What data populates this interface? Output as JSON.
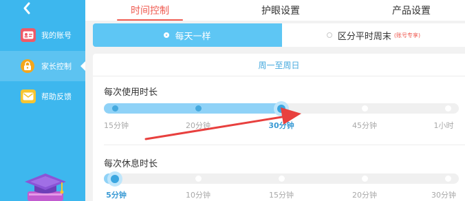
{
  "colors": {
    "sidebar": "#3db7ee",
    "accent_red": "#ef5a50",
    "accent_blue": "#5ec6f4",
    "arrow": "#e8403e"
  },
  "sidebar": {
    "back_icon": "chevron-left-icon",
    "items": [
      {
        "label": "我的账号",
        "icon": "id-card-icon",
        "active": false
      },
      {
        "label": "家长控制",
        "icon": "lock-icon",
        "active": true
      },
      {
        "label": "帮助反馈",
        "icon": "mail-icon",
        "active": false
      }
    ],
    "bottom_icon": "graduation-cap-icon"
  },
  "tabs": [
    {
      "label": "时间控制",
      "active": true
    },
    {
      "label": "护眼设置",
      "active": false
    },
    {
      "label": "产品设置",
      "active": false
    }
  ],
  "mode": {
    "selected": "每天一样",
    "other": "区分平时周末",
    "other_note": "(账号专享)"
  },
  "day_range": "周一至周日",
  "usage": {
    "title": "每次使用时长",
    "ticks": [
      "15分钟",
      "20分钟",
      "30分钟",
      "45分钟",
      "1小时"
    ],
    "selected_index": 2
  },
  "rest": {
    "title": "每次休息时长",
    "ticks": [
      "5分钟",
      "10分钟",
      "15分钟",
      "20分钟",
      "30分钟"
    ],
    "selected_index": 0
  }
}
